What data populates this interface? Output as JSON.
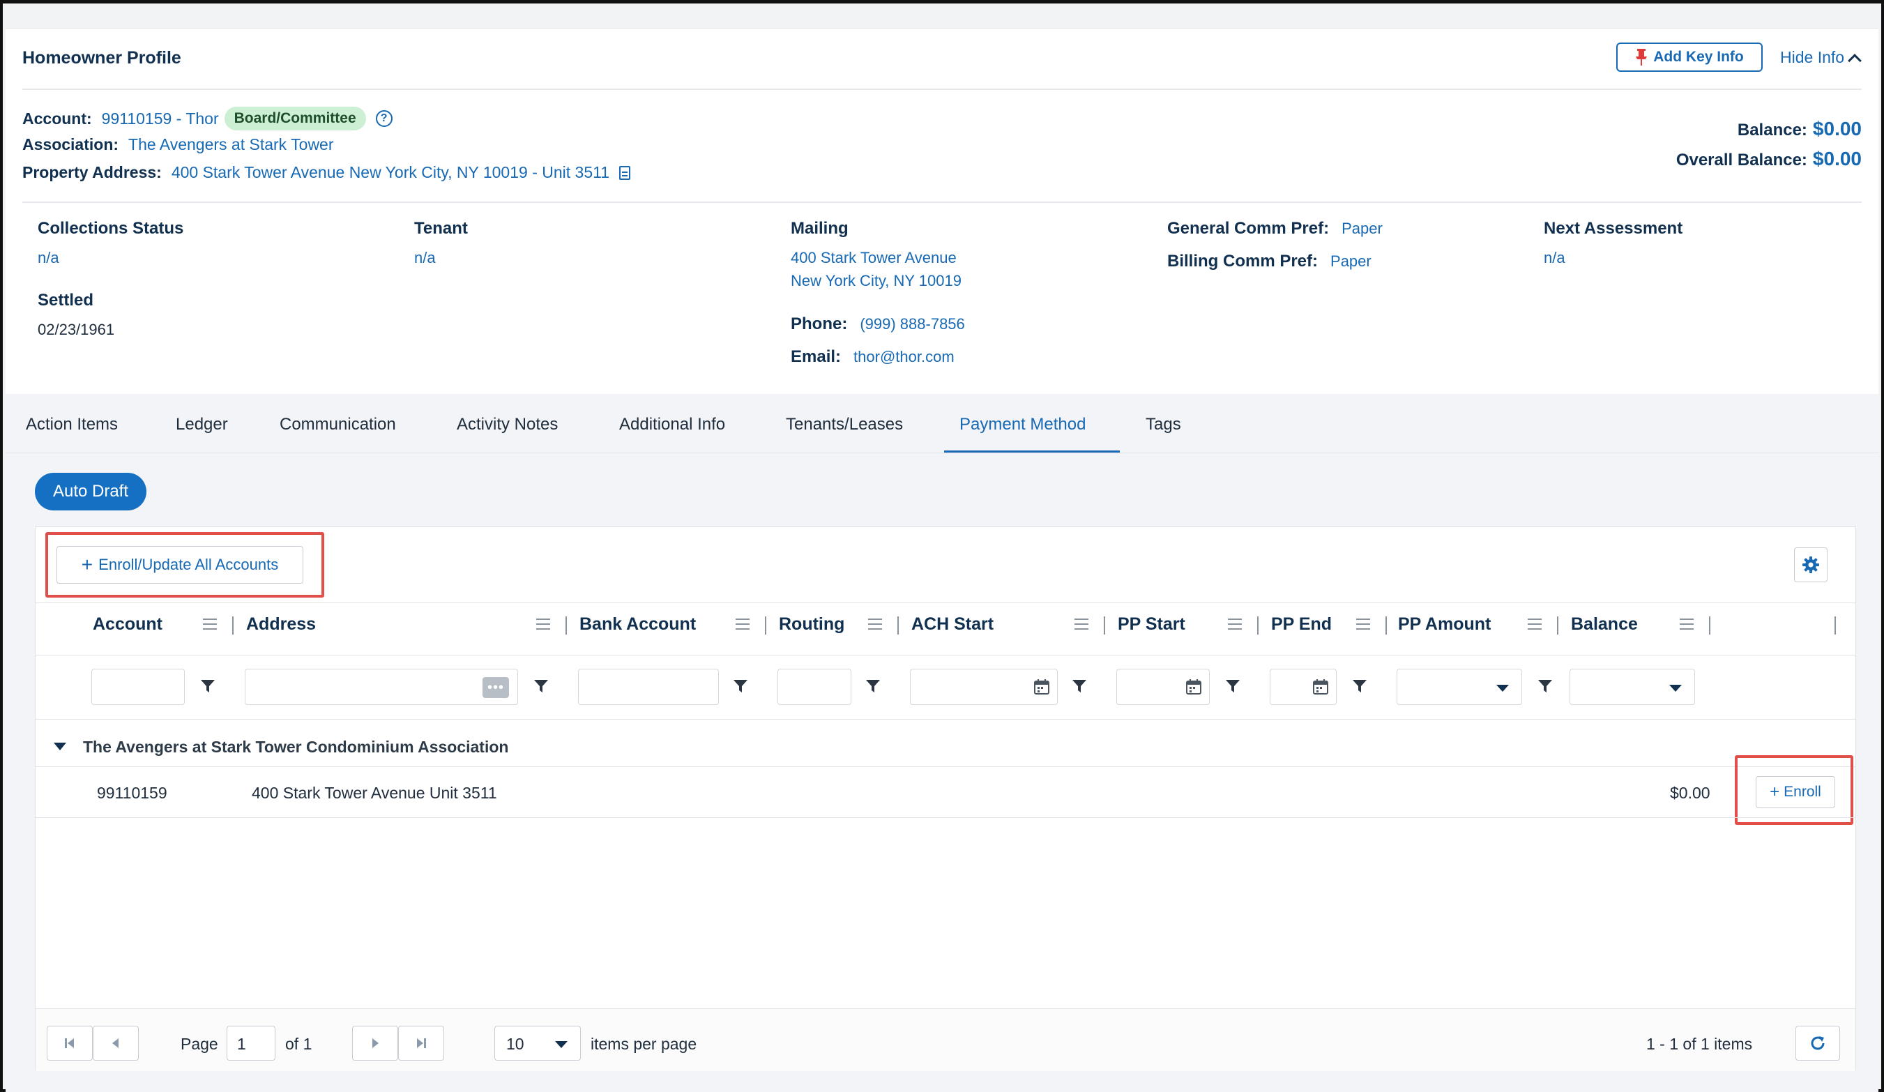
{
  "profile": {
    "title": "Homeowner Profile",
    "add_key_info": "Add Key Info",
    "hide_info": "Hide Info",
    "account_label": "Account:",
    "account_value": "99110159 - Thor",
    "badge": "Board/Committee",
    "help": "?",
    "association_label": "Association:",
    "association_value": "The Avengers at Stark Tower",
    "property_label": "Property Address:",
    "property_value": "400 Stark Tower Avenue New York City, NY 10019 - Unit 3511",
    "balance_label": "Balance:",
    "balance_value": "$0.00",
    "overall_label": "Overall Balance:",
    "overall_value": "$0.00"
  },
  "details": {
    "collections_label": "Collections Status",
    "collections_value": "n/a",
    "settled_label": "Settled",
    "settled_value": "02/23/1961",
    "tenant_label": "Tenant",
    "tenant_value": "n/a",
    "mailing_label": "Mailing",
    "mailing_line1": "400 Stark Tower Avenue",
    "mailing_line2": "New York City, NY 10019",
    "phone_label": "Phone:",
    "phone_value": "(999) 888-7856",
    "email_label": "Email:",
    "email_value": "thor@thor.com",
    "general_comm_label": "General Comm Pref:",
    "general_comm_value": "Paper",
    "billing_comm_label": "Billing Comm Pref:",
    "billing_comm_value": "Paper",
    "next_assessment_label": "Next Assessment",
    "next_assessment_value": "n/a"
  },
  "tabs": [
    {
      "label": "Action Items"
    },
    {
      "label": "Ledger"
    },
    {
      "label": "Communication"
    },
    {
      "label": "Activity Notes"
    },
    {
      "label": "Additional Info"
    },
    {
      "label": "Tenants/Leases"
    },
    {
      "label": "Payment Method",
      "active": true
    },
    {
      "label": "Tags"
    }
  ],
  "auto_draft": "Auto Draft",
  "grid": {
    "enroll_all_label": "Enroll/Update All Accounts",
    "columns": [
      "Account",
      "Address",
      "Bank Account",
      "Routing",
      "ACH Start",
      "PP Start",
      "PP End",
      "PP Amount",
      "Balance"
    ],
    "group_label": "The Avengers at Stark Tower Condominium Association",
    "row": {
      "account": "99110159",
      "address": "400 Stark Tower Avenue Unit 3511",
      "balance": "$0.00",
      "action": "Enroll"
    }
  },
  "pager": {
    "page_label": "Page",
    "page_value": "1",
    "of_label": "of 1",
    "page_size": "10",
    "items_per_page": "items per page",
    "summary": "1 - 1 of 1 items"
  },
  "colors": {
    "accent": "#1769b3",
    "primary_button": "#1570c4",
    "badge_bg": "#cdf0d5",
    "highlight": "#e0504a",
    "pin": "#e03b3b"
  }
}
